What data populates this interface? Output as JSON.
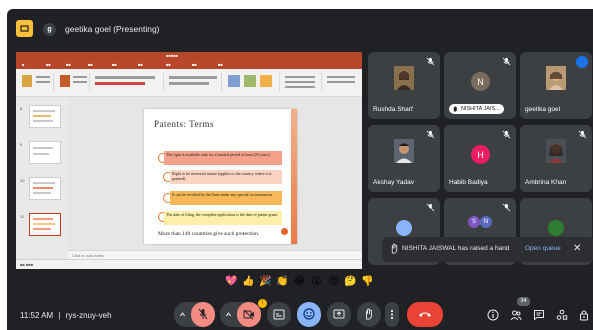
{
  "meeting": {
    "presenter_initial": "g",
    "presenting_label": "geetika goel (Presenting)",
    "time": "11:52 AM",
    "separator": "|",
    "meeting_code": "rys-znuy-veh"
  },
  "presentation": {
    "slide_title": "Patents: Terms",
    "rows": [
      "The right is available only for a limited period of time (20 years).",
      "Right to be territorial nature (applies to the country where it is granted).",
      "It can be revoked by the State under any special circumstances.",
      "The date of filing, the complete application is the date of patent grant."
    ],
    "last_line": "More than 140 countries give such protection.",
    "thumb_numbers": [
      "8",
      "9",
      "10",
      "11"
    ],
    "notes_hint": "Click to add notes"
  },
  "participants": [
    {
      "name": "Rushda Sharf",
      "type": "photo",
      "muted": true
    },
    {
      "name": "NISHITA JAIS...",
      "type": "avatar",
      "initial": "N",
      "color": "#7b6b5c",
      "muted": true,
      "hand_raised": true
    },
    {
      "name": "geetika goel",
      "type": "photo",
      "muted": false,
      "speaking": true
    },
    {
      "name": "Akshay Yadav",
      "type": "photo",
      "muted": true
    },
    {
      "name": "Habib Badiya",
      "type": "avatar",
      "initial": "H",
      "color": "#e91e63",
      "muted": true
    },
    {
      "name": "Ambrina Khan",
      "type": "photo",
      "muted": true
    }
  ],
  "partial_tile": {
    "initials": [
      "S",
      "N"
    ]
  },
  "toast": {
    "message": "NISHITA JAISWAL has raised a hand",
    "action": "Open queue",
    "close": "✕"
  },
  "reactions": [
    "💖",
    "👍",
    "🎉",
    "👏",
    "😂",
    "😮",
    "😢",
    "🤔",
    "👎"
  ],
  "controls": {
    "people_count": "34",
    "present_badge": "!"
  },
  "colors": {
    "meet_bg": "#202124",
    "tile_bg": "#3c4043",
    "leave_red": "#ea4335",
    "mic_off_red": "#f28b82",
    "accent_blue": "#8ab4f8",
    "ppt_orange": "#b7472a"
  }
}
